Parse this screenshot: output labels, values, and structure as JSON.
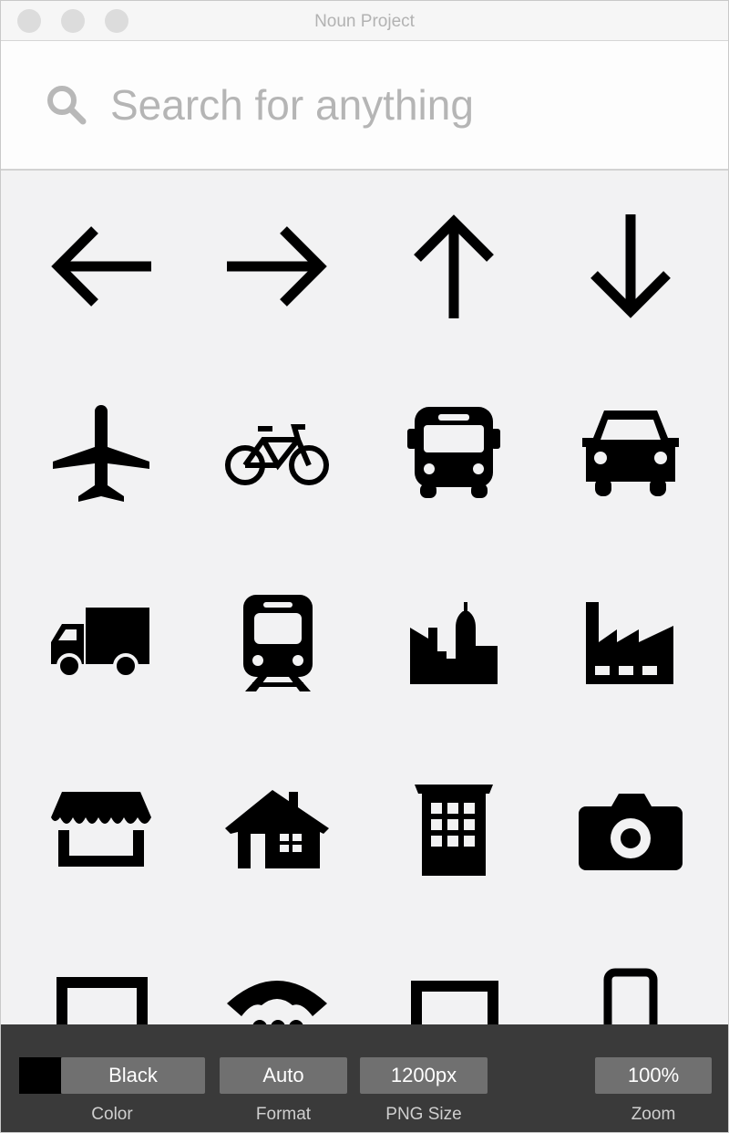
{
  "window": {
    "title": "Noun Project"
  },
  "search": {
    "placeholder": "Search for anything"
  },
  "icons": [
    "arrow-left-icon",
    "arrow-right-icon",
    "arrow-up-icon",
    "arrow-down-icon",
    "airplane-icon",
    "bicycle-icon",
    "bus-icon",
    "car-icon",
    "truck-icon",
    "train-icon",
    "city-skyline-icon",
    "factory-icon",
    "storefront-icon",
    "house-icon",
    "office-building-icon",
    "camera-icon",
    "picture-frame-icon",
    "telephone-icon",
    "frame-icon",
    "mobile-phone-icon"
  ],
  "toolbar": {
    "color": {
      "value": "Black",
      "label": "Color",
      "swatch": "#000000"
    },
    "format": {
      "value": "Auto",
      "label": "Format"
    },
    "png_size": {
      "value": "1200px",
      "label": "PNG Size"
    },
    "zoom": {
      "value": "100%",
      "label": "Zoom"
    }
  }
}
